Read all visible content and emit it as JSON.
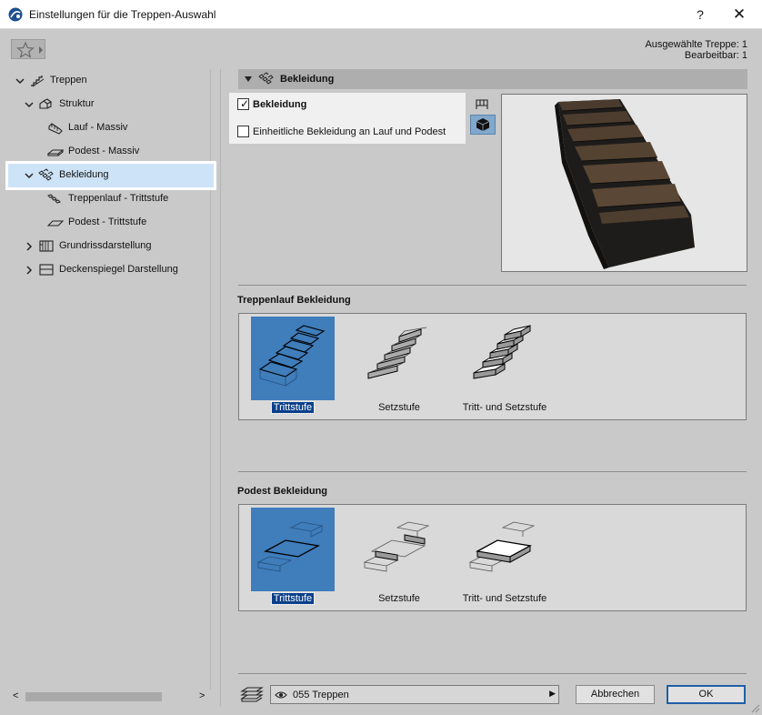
{
  "window": {
    "title": "Einstellungen für die Treppen-Auswahl",
    "help_label": "?",
    "close_label": "✕"
  },
  "info": {
    "selected": "Ausgewählte Treppe: 1",
    "editable": "Bearbeitbar: 1"
  },
  "tree": {
    "items": [
      {
        "label": "Treppen",
        "icon": "stair-icon",
        "expanded": true
      },
      {
        "label": "Struktur",
        "icon": "structure-icon",
        "expanded": true
      },
      {
        "label": "Lauf - Massiv",
        "icon": "flight-icon"
      },
      {
        "label": "Podest - Massiv",
        "icon": "landing-icon"
      },
      {
        "label": "Bekleidung",
        "icon": "finish-icon",
        "expanded": true,
        "selected": true
      },
      {
        "label": "Treppenlauf - Trittstufe",
        "icon": "flight-tread-icon"
      },
      {
        "label": "Podest - Trittstufe",
        "icon": "landing-tread-icon"
      },
      {
        "label": "Grundrissdarstellung",
        "icon": "floor-plan-icon",
        "expanded": false
      },
      {
        "label": "Deckenspiegel Darstellung",
        "icon": "ceiling-plan-icon",
        "expanded": false
      }
    ]
  },
  "section": {
    "title": "Bekleidung"
  },
  "options": {
    "bekleidung_label": "Bekleidung",
    "bekleidung_checked": true,
    "einheitlich_label": "Einheitliche Bekleidung an Lauf und Podest",
    "einheitlich_checked": false
  },
  "flight_group": {
    "title": "Treppenlauf Bekleidung",
    "tiles": [
      {
        "label": "Trittstufe",
        "selected": true
      },
      {
        "label": "Setzstufe",
        "selected": false
      },
      {
        "label": "Tritt- und Setzstufe",
        "selected": false
      }
    ]
  },
  "landing_group": {
    "title": "Podest Bekleidung",
    "tiles": [
      {
        "label": "Trittstufe",
        "selected": true
      },
      {
        "label": "Setzstufe",
        "selected": false
      },
      {
        "label": "Tritt- und Setzstufe",
        "selected": false
      }
    ]
  },
  "footer": {
    "layer": "055 Treppen",
    "cancel_label": "Abbrechen",
    "ok_label": "OK"
  },
  "colors": {
    "selection": "#cde3f7",
    "tile_selected": "#3f7dbb",
    "caption_selected": "#0a3f8a"
  }
}
